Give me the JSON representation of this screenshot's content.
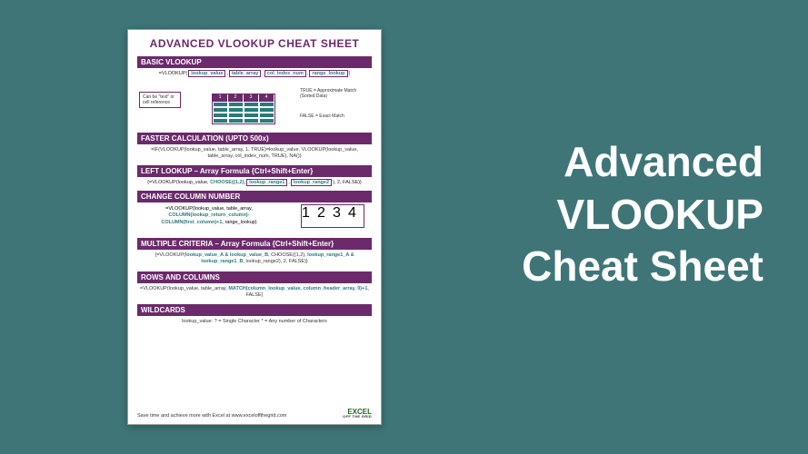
{
  "headline": {
    "l1": "Advanced",
    "l2": "VLOOKUP",
    "l3": "Cheat Sheet"
  },
  "sheet": {
    "title": "ADVANCED VLOOKUP CHEAT SHEET",
    "basic": {
      "bar": "BASIC VLOOKUP",
      "prefix": "=VLOOKUP(",
      "p1": "lookup_value",
      "c1": ",",
      "p2": "table_array",
      "c2": ",",
      "p3": "col_index_num",
      "c3": ",",
      "p4": "range_lookup",
      "suffix": ")",
      "note_left": "Can be \"text\" or cell reference",
      "note_r1": "TRUE = Approximate Match (Sorted Data)",
      "note_r2": "FALSE = Exact Match",
      "hdr1": "1",
      "hdr2": "2",
      "hdr3": "3",
      "hdr4": "4"
    },
    "faster": {
      "bar": "FASTER CALCULATION (UPTO 500x)",
      "body": "=IF(VLOOKUP(lookup_value, table_array, 1, TRUE)=lookup_value, VLOOKUP(lookup_value, table_array, col_index_num, TRUE), NA())"
    },
    "left": {
      "bar": "LEFT LOOKUP – Array Formula {Ctrl+Shift+Enter}",
      "prefix": "{=VLOOKUP(lookup_value, ",
      "choose": "CHOOSE({1,2},",
      "p1": "lookup_range1",
      "c1": ",",
      "p2": "lookup_range2",
      "suffix": "), 2, FALSE)}"
    },
    "change": {
      "bar": "CHANGE COLUMN NUMBER",
      "l1a": "=VLOOKUP(lookup_value, table_array,",
      "l2a": "COLUMN(lookup_return_column)-",
      "l2b": "COLUMN(first_column)+1",
      "l3": ", range_lookup)",
      "hdr1": "1",
      "hdr2": "2",
      "hdr3": "3",
      "hdr4": "4"
    },
    "multi": {
      "bar": "MULTIPLE CRITERIA – Array Formula {Ctrl+Shift+Enter}",
      "body_a": "{=VLOOKUP(",
      "body_b": "lookup_value_A & lookup_value_B",
      "body_c": ", CHOOSE({1,2}, ",
      "body_d": "lookup_range1_A & lookup_range1_B",
      "body_e": ", lookup_range2), 2, FALSE)}"
    },
    "rows": {
      "bar": "ROWS AND COLUMNS",
      "body_a": "=VLOOKUP(lookup_value, table_array, ",
      "body_b": "MATCH(column_lookup_value, column_header_array, 0)+1",
      "body_c": ", FALSE)"
    },
    "wild": {
      "bar": "WILDCARDS",
      "body": "lookup_value:   ? = Single Character   * = Any number of Characters"
    },
    "footer": {
      "text": "Save time and achieve more with Excel at www.exceloffthegrid.com",
      "logo1": "EXCEL",
      "logo2": "OFF THE GRID"
    }
  }
}
